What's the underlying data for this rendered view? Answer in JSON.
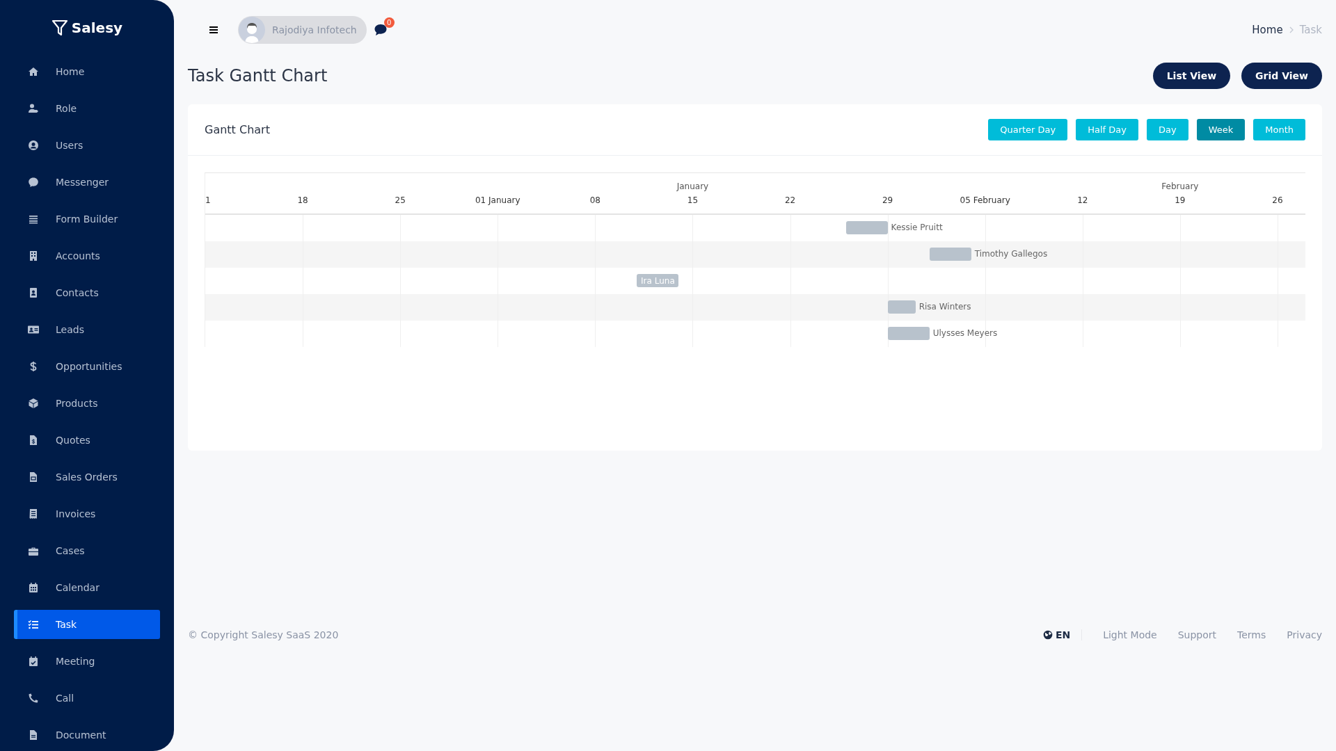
{
  "sidebar": {
    "logo": "Salesy",
    "items": [
      {
        "label": "Home",
        "selected": false
      },
      {
        "label": "Role",
        "selected": false
      },
      {
        "label": "Users",
        "selected": false
      },
      {
        "label": "Messenger",
        "selected": false
      },
      {
        "label": "Form Builder",
        "selected": false
      },
      {
        "label": "Accounts",
        "selected": false
      },
      {
        "label": "Contacts",
        "selected": false
      },
      {
        "label": "Leads",
        "selected": false
      },
      {
        "label": "Opportunities",
        "selected": false
      },
      {
        "label": "Products",
        "selected": false
      },
      {
        "label": "Quotes",
        "selected": false
      },
      {
        "label": "Sales Orders",
        "selected": false
      },
      {
        "label": "Invoices",
        "selected": false
      },
      {
        "label": "Cases",
        "selected": false
      },
      {
        "label": "Calendar",
        "selected": false
      },
      {
        "label": "Task",
        "selected": true
      },
      {
        "label": "Meeting",
        "selected": false
      },
      {
        "label": "Call",
        "selected": false
      },
      {
        "label": "Document",
        "selected": false
      }
    ]
  },
  "topbar": {
    "user": "Rajodiya Infotech",
    "message_count": "0",
    "breadcrumb": [
      "Home",
      "Task"
    ]
  },
  "page": {
    "title": "Task Gantt Chart",
    "actions": [
      "List View",
      "Grid View"
    ]
  },
  "gantt": {
    "title": "Gantt Chart",
    "views": [
      {
        "label": "Quarter Day",
        "selected": false
      },
      {
        "label": "Half Day",
        "selected": false
      },
      {
        "label": "Day",
        "selected": false
      },
      {
        "label": "Week",
        "selected": true
      },
      {
        "label": "Month",
        "selected": false
      }
    ],
    "months": [
      "January",
      "February"
    ],
    "ticks": [
      "1",
      "18",
      "25",
      "01 January",
      "08",
      "15",
      "22",
      "29",
      "05 February",
      "12",
      "19",
      "26"
    ],
    "tasks": [
      {
        "name": "Kessie Pruitt"
      },
      {
        "name": "Timothy Gallegos"
      },
      {
        "name": "Ira Luna"
      },
      {
        "name": "Risa Winters"
      },
      {
        "name": "Ulysses Meyers"
      }
    ]
  },
  "footer": {
    "copyright": "© Copyright Salesy SaaS 2020",
    "language": "EN",
    "links": [
      "Light Mode",
      "Support",
      "Terms",
      "Privacy"
    ]
  }
}
